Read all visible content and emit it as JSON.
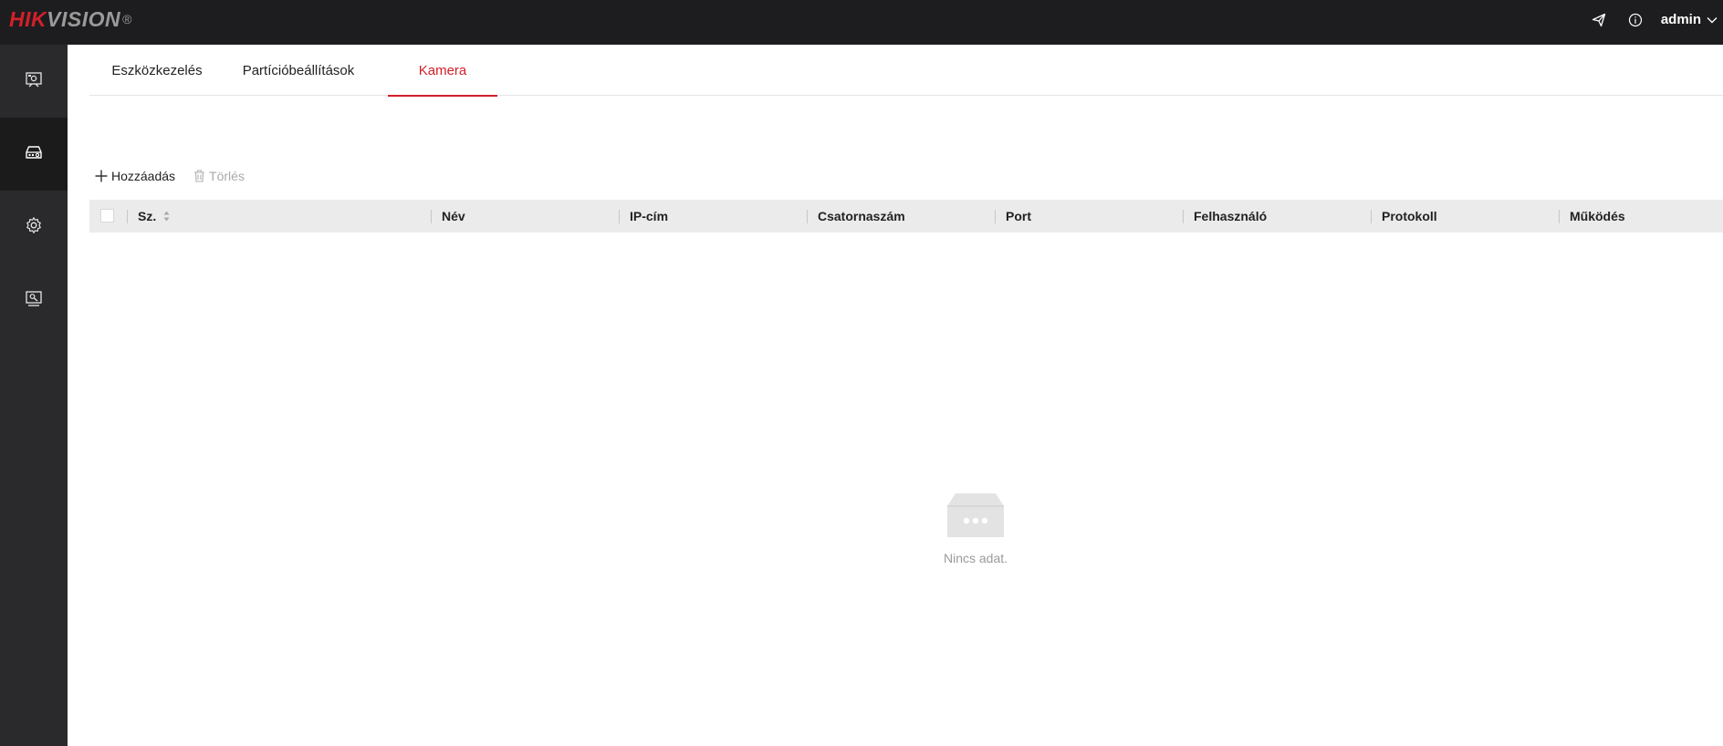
{
  "brand": {
    "part1": "HIK",
    "part2": "VISION",
    "reg": "®"
  },
  "header": {
    "user": "admin",
    "icons": [
      "send-icon",
      "info-icon",
      "chevron-down-icon"
    ]
  },
  "sidebar": {
    "items": [
      {
        "icon": "preview-icon",
        "active": false
      },
      {
        "icon": "device-icon",
        "active": true
      },
      {
        "icon": "settings-gear-icon",
        "active": false
      },
      {
        "icon": "maintenance-icon",
        "active": false
      }
    ]
  },
  "tabs": [
    {
      "label": "Eszközkezelés",
      "active": false
    },
    {
      "label": "Partícióbeállítások",
      "active": false
    },
    {
      "label": "Kamera",
      "active": true
    }
  ],
  "toolbar": {
    "add_label": "Hozzáadás",
    "delete_label": "Törlés"
  },
  "table": {
    "columns": [
      "Sz.",
      "Név",
      "IP-cím",
      "Csatornaszám",
      "Port",
      "Felhasználó",
      "Protokoll",
      "Működés"
    ],
    "rows": []
  },
  "empty": {
    "text": "Nincs adat."
  },
  "colors": {
    "accent": "#d2202a",
    "topbar": "#1d1d1f",
    "sidebar": "#2a2a2c",
    "sidebar_active": "#1b1b1c",
    "header_row": "#ebebeb"
  }
}
